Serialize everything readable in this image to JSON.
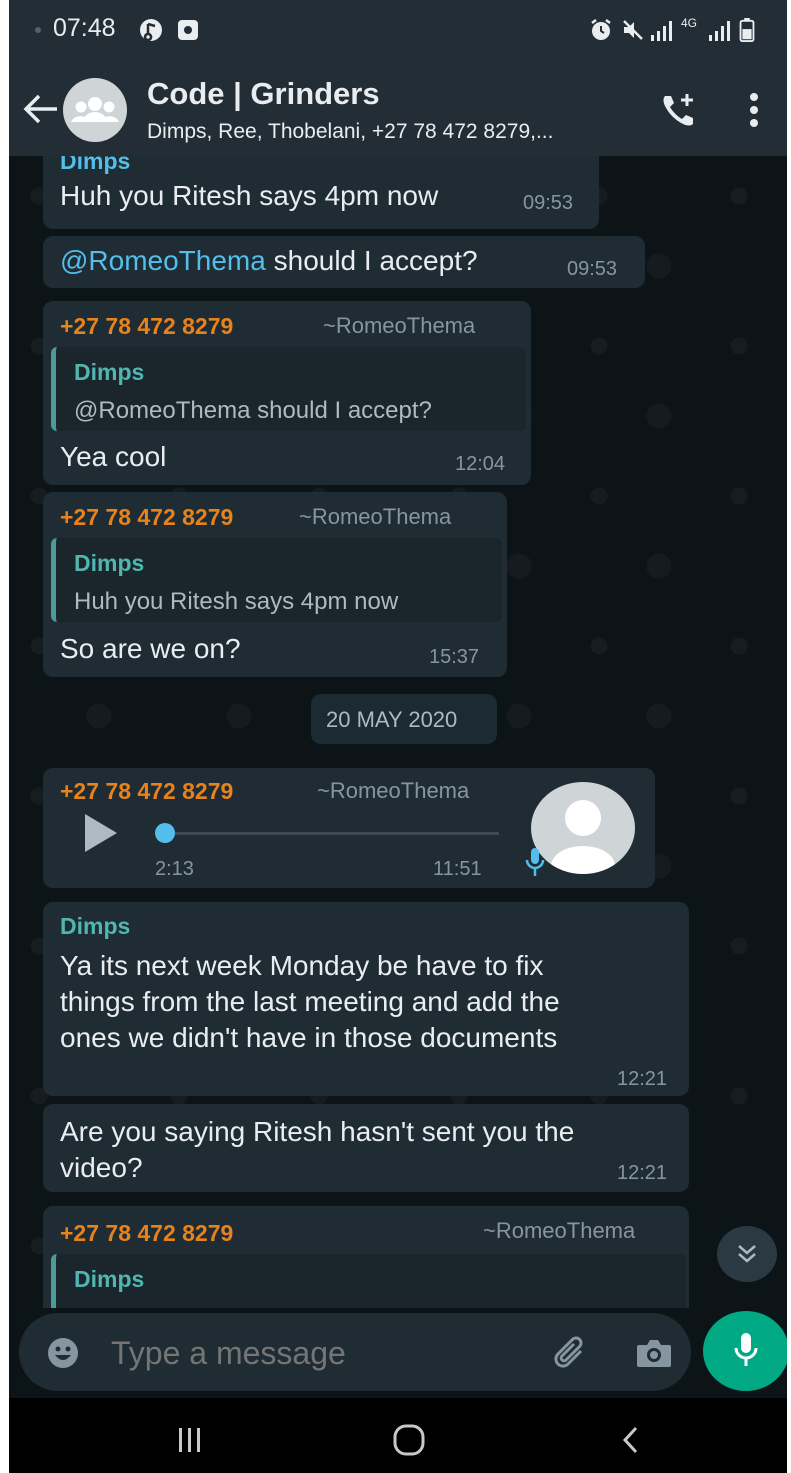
{
  "status_bar": {
    "time": "07:48",
    "network": "4G"
  },
  "header": {
    "title": "Code | Grinders",
    "subtitle": "Dimps, Ree, Thobelani, +27 78 472 8279,..."
  },
  "messages": {
    "m1": {
      "sender": "Dimps",
      "text": "Huh you Ritesh says 4pm now",
      "time": "09:53"
    },
    "m2": {
      "mention": "@RomeoThema",
      "text": " should I accept?",
      "time": "09:53"
    },
    "m3": {
      "sender": "+27 78 472 8279",
      "push_name": "~RomeoThema",
      "quote_name": "Dimps",
      "quote_text": "@RomeoThema should I accept?",
      "text": "Yea cool",
      "time": "12:04"
    },
    "m4": {
      "sender": "+27 78 472 8279",
      "push_name": "~RomeoThema",
      "quote_name": "Dimps",
      "quote_text": "Huh you Ritesh says 4pm now",
      "text": "So are we on?",
      "time": "15:37"
    },
    "date_chip": "20 MAY 2020",
    "m5": {
      "sender": "+27 78 472 8279",
      "push_name": "~RomeoThema",
      "duration": "2:13",
      "time": "11:51",
      "progress": 0.0
    },
    "m6": {
      "sender": "Dimps",
      "line1": "Ya its next week Monday be have to fix",
      "line2": "things from the last meeting and add the",
      "line3": "ones we didn't have in those documents",
      "time": "12:21"
    },
    "m7": {
      "line1": "Are you saying Ritesh hasn't sent you the",
      "line2": "video?",
      "time": "12:21"
    },
    "m8": {
      "sender": "+27 78 472 8279",
      "push_name": "~RomeoThema",
      "quote_name": "Dimps"
    }
  },
  "composer": {
    "placeholder": "Type a message"
  },
  "colors": {
    "accent": "#00a884",
    "sender_orange": "#e8821b",
    "sender_teal": "#53bdeb",
    "bubble": "#1f2c34",
    "background": "#0d1418"
  }
}
